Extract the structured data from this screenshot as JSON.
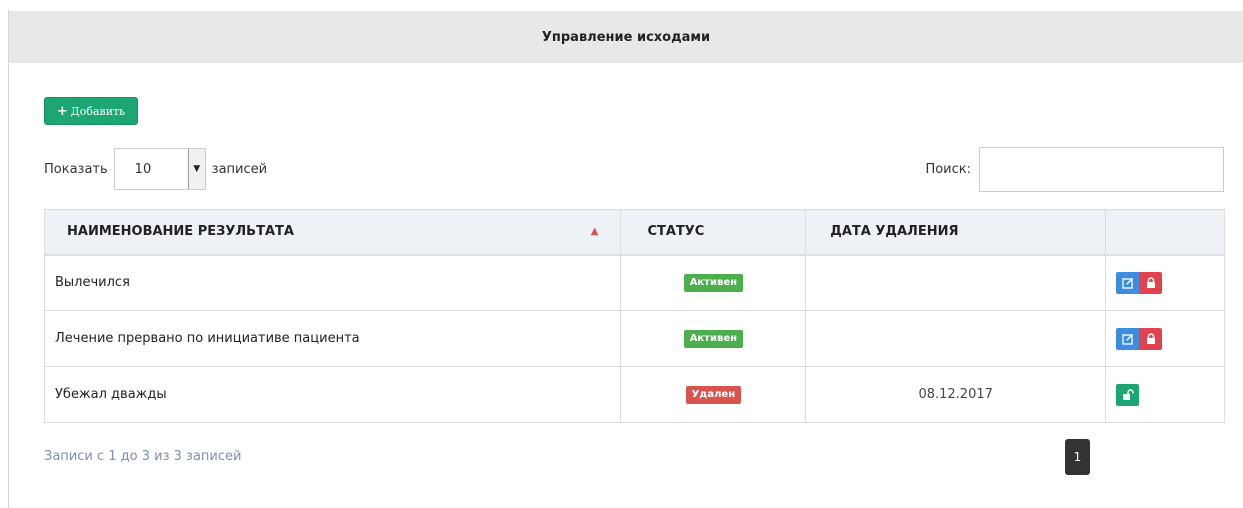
{
  "panel": {
    "title": "Управление исходами"
  },
  "toolbar": {
    "add_label": "Добавить",
    "add_icon": "plus-icon"
  },
  "length": {
    "prefix": "Показать",
    "value": "10",
    "suffix": "записей"
  },
  "search": {
    "label": "Поиск:",
    "value": "",
    "placeholder": ""
  },
  "table": {
    "columns": [
      "НАИМЕНОВАНИЕ РЕЗУЛЬТАТА",
      "СТАТУС",
      "ДАТА УДАЛЕНИЯ",
      ""
    ],
    "sort": {
      "column": 0,
      "direction": "ascending"
    },
    "rows": [
      {
        "name": "Вылечился",
        "status": "Активен",
        "status_kind": "active",
        "deleted_date": "",
        "actions": [
          "edit-icon",
          "lock-icon"
        ]
      },
      {
        "name": "Лечение прервано по инициативе пациента",
        "status": "Активен",
        "status_kind": "active",
        "deleted_date": "",
        "actions": [
          "edit-icon",
          "lock-icon"
        ]
      },
      {
        "name": "Убежал дважды",
        "status": "Удален",
        "status_kind": "deleted",
        "deleted_date": "08.12.2017",
        "actions": [
          "unlock-icon"
        ]
      }
    ]
  },
  "footer": {
    "info": "Записи с 1 до 3 из 3 записей",
    "page": "1"
  },
  "colors": {
    "header_bg": "#e8e8e8",
    "add_button": "#1ba673",
    "badge_active": "#4cae4c",
    "badge_deleted": "#d9534f",
    "edit_button": "#3c8dde",
    "lock_button": "#e0424e",
    "unlock_button": "#1ba673",
    "info_text": "#7b8fb0",
    "page_button": "#333333"
  }
}
